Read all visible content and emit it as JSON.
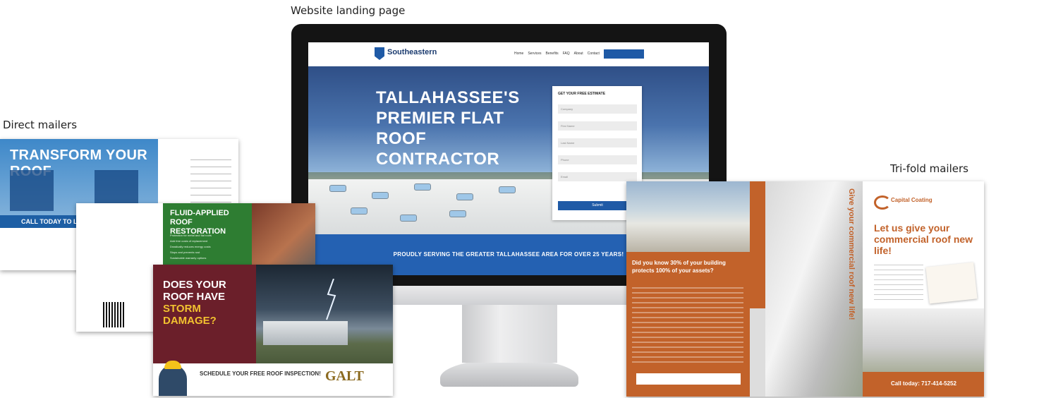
{
  "captions": {
    "website": "Website landing page",
    "direct": "Direct mailers",
    "trifold": "Tri-fold mailers"
  },
  "website": {
    "brand": "Southeastern",
    "nav": [
      "Home",
      "Services",
      "Benefits",
      "FAQ",
      "About",
      "Contact"
    ],
    "hero_title": "TALLAHASSEE'S PREMIER FLAT ROOF CONTRACTOR",
    "form_title": "GET YOUR FREE ESTIMATE",
    "form_fields": [
      "Company",
      "First Name",
      "Last Name",
      "Phone",
      "Email"
    ],
    "form_submit": "Submit",
    "banner": "PROUDLY SERVING THE GREATER TALLAHASSEE AREA FOR OVER 25 YEARS!"
  },
  "mailer1": {
    "title": "TRANSFORM YOUR ROOF",
    "cta": "CALL TODAY TO LEARN"
  },
  "mailer2": {
    "title": "FLUID-APPLIED ROOF RESTORATION",
    "bullets": [
      "Protection for metal and flat roofs",
      "Add free costs of replacement",
      "Drastically reduces energy costs",
      "Stops and prevents rust",
      "Sustainable warranty options"
    ]
  },
  "mailer3": {
    "title_line1": "DOES YOUR ROOF HAVE",
    "title_line2": "STORM DAMAGE?",
    "cta": "SCHEDULE YOUR FREE ROOF INSPECTION!",
    "brand": "GALT"
  },
  "trifold": {
    "panel1_head": "Did you know 30% of your building protects 100% of your assets?",
    "panel2_head": "Give your commercial roof new life!",
    "brand": "Capital Coating",
    "head": "Let us give your commercial roof new life!",
    "call": "Call today: 717-414-5252"
  }
}
